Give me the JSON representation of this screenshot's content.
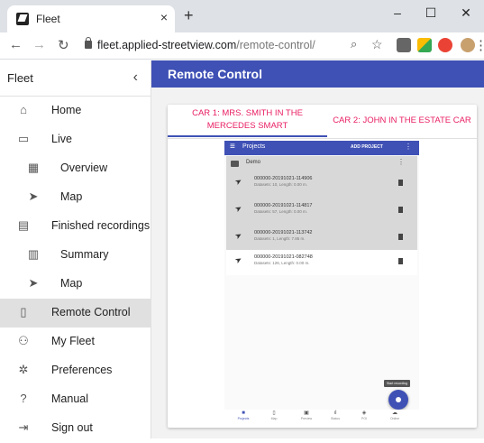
{
  "browser": {
    "tab_title": "Fleet",
    "tab_close": "×",
    "new_tab": "+",
    "minimize": "–",
    "maximize": "☐",
    "close": "✕",
    "url_domain": "fleet.applied-streetview.com",
    "url_path": "/remote-control/",
    "extension_colors": [
      "#1a73e8",
      "#34a853",
      "#ea4335",
      "#e37400"
    ]
  },
  "sidebar": {
    "title": "Fleet",
    "collapse_glyph": "‹",
    "items": [
      {
        "label": "Home",
        "icon": "home-icon"
      },
      {
        "label": "Live",
        "icon": "tv-icon"
      },
      {
        "label": "Overview",
        "icon": "dashboard-icon"
      },
      {
        "label": "Map",
        "icon": "navigation-icon"
      },
      {
        "label": "Finished recordings",
        "icon": "assignment-icon"
      },
      {
        "label": "Summary",
        "icon": "chart-icon"
      },
      {
        "label": "Map",
        "icon": "navigation-icon"
      },
      {
        "label": "Remote Control",
        "icon": "phone-remote-icon"
      },
      {
        "label": "My Fleet",
        "icon": "group-icon"
      },
      {
        "label": "Preferences",
        "icon": "gear-icon"
      },
      {
        "label": "Manual",
        "icon": "help-icon"
      },
      {
        "label": "Sign out",
        "icon": "exit-icon"
      }
    ]
  },
  "header": {
    "title": "Remote Control"
  },
  "car_tabs": [
    {
      "label": "CAR 1: MRS. SMITH IN THE MERCEDES SMART",
      "selected": true
    },
    {
      "label": "CAR 2: JOHN IN THE ESTATE CAR",
      "selected": false
    }
  ],
  "phone": {
    "title": "Projects",
    "add_project": "ADD PROJECT",
    "folder": "Demo",
    "recordings": [
      {
        "name": "000000-20191021-114906",
        "meta": "Datasets: 10, Length: 0.00 m."
      },
      {
        "name": "000000-20191021-114817",
        "meta": "Datasets: 57, Length: 0.00 m."
      },
      {
        "name": "000000-20191021-113742",
        "meta": "Datasets: 1, Length: 7.85 m."
      },
      {
        "name": "000000-20191021-082748",
        "meta": "Datasets: 126, Length: 0.00 m."
      }
    ],
    "tooltip": "Start recording",
    "bottom_nav": [
      {
        "label": "Projects",
        "icon": "folder-icon"
      },
      {
        "label": "Map",
        "icon": "map-icon"
      },
      {
        "label": "Preview",
        "icon": "image-icon"
      },
      {
        "label": "Status",
        "icon": "bar-chart-icon"
      },
      {
        "label": "POI",
        "icon": "poi-icon"
      },
      {
        "label": "Online",
        "icon": "cloud-icon"
      }
    ]
  },
  "colors": {
    "accent": "#3f51b5",
    "tab_text": "#e91e63"
  }
}
